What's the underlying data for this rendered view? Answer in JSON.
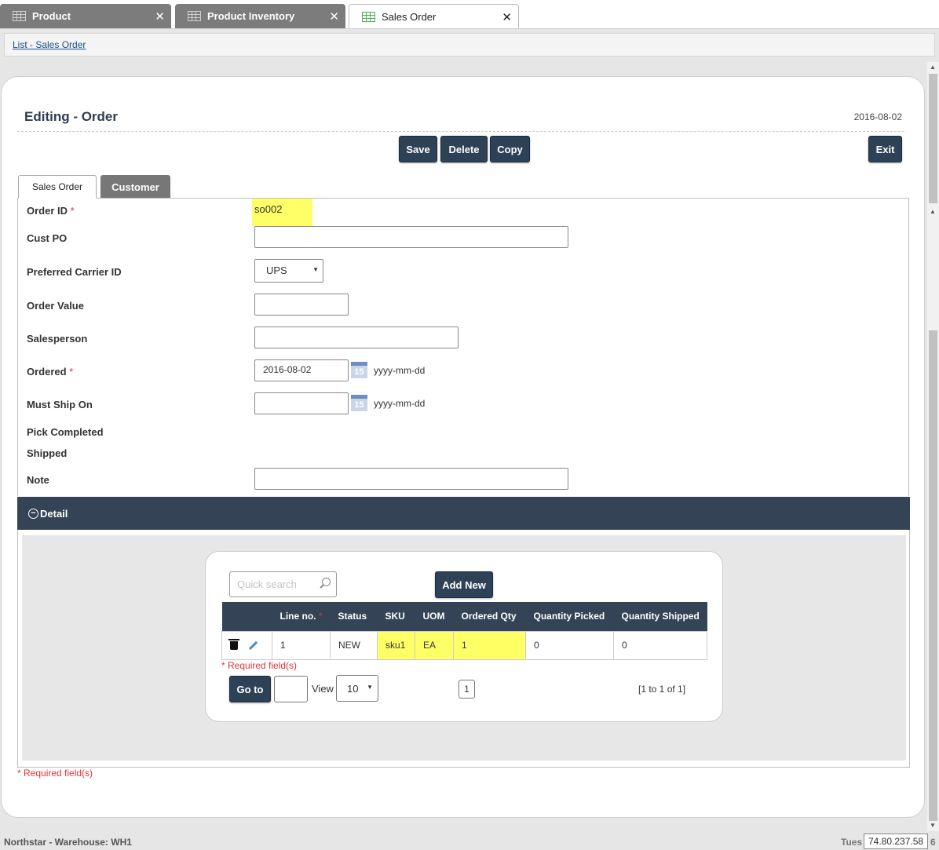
{
  "app_tabs": [
    {
      "label": "Product"
    },
    {
      "label": "Product Inventory"
    },
    {
      "label": "Sales Order"
    }
  ],
  "breadcrumb": {
    "link": "List - Sales Order"
  },
  "header": {
    "title": "Editing - Order",
    "date": "2016-08-02"
  },
  "toolbar": {
    "save": "Save",
    "delete": "Delete",
    "copy": "Copy",
    "exit": "Exit"
  },
  "form_tabs": {
    "sales_order": "Sales Order",
    "customer": "Customer"
  },
  "form": {
    "order_id_label": "Order ID",
    "order_id_value": "so002",
    "cust_po_label": "Cust PO",
    "cust_po_value": "",
    "carrier_label": "Preferred Carrier ID",
    "carrier_value": "UPS",
    "order_value_label": "Order Value",
    "order_value_value": "",
    "salesperson_label": "Salesperson",
    "salesperson_value": "",
    "ordered_label": "Ordered",
    "ordered_value": "2016-08-02",
    "must_ship_label": "Must Ship On",
    "must_ship_value": "",
    "date_hint": "yyyy-mm-dd",
    "calendar_day": "15",
    "pick_completed_label": "Pick Completed",
    "shipped_label": "Shipped",
    "note_label": "Note",
    "note_value": "",
    "required_mark": "*"
  },
  "detail": {
    "title": "Detail",
    "search_placeholder": "Quick search",
    "add_new": "Add New",
    "columns": [
      "Line no.",
      "Status",
      "SKU",
      "UOM",
      "Ordered Qty",
      "Quantity Picked",
      "Quantity Shipped"
    ],
    "rows": [
      {
        "line_no": "1",
        "status": "NEW",
        "sku": "sku1",
        "uom": "EA",
        "ordered_qty": "1",
        "qty_picked": "0",
        "qty_shipped": "0"
      }
    ],
    "required_note": "* Required field(s)",
    "goto_label": "Go to",
    "view_label": "View",
    "page_size": "10",
    "current_page": "1",
    "range_text": "[1 to 1 of 1]"
  },
  "required_note": "* Required field(s)",
  "footer": {
    "left": "Northstar - Warehouse: WH1",
    "right_partial": "Tues",
    "ip": "74.80.237.58",
    "edge_char": "6"
  },
  "colors": {
    "accent": "#344456",
    "highlight": "#ffff66",
    "required": "#d9363e",
    "inactive_tab": "#7c7c7c"
  }
}
